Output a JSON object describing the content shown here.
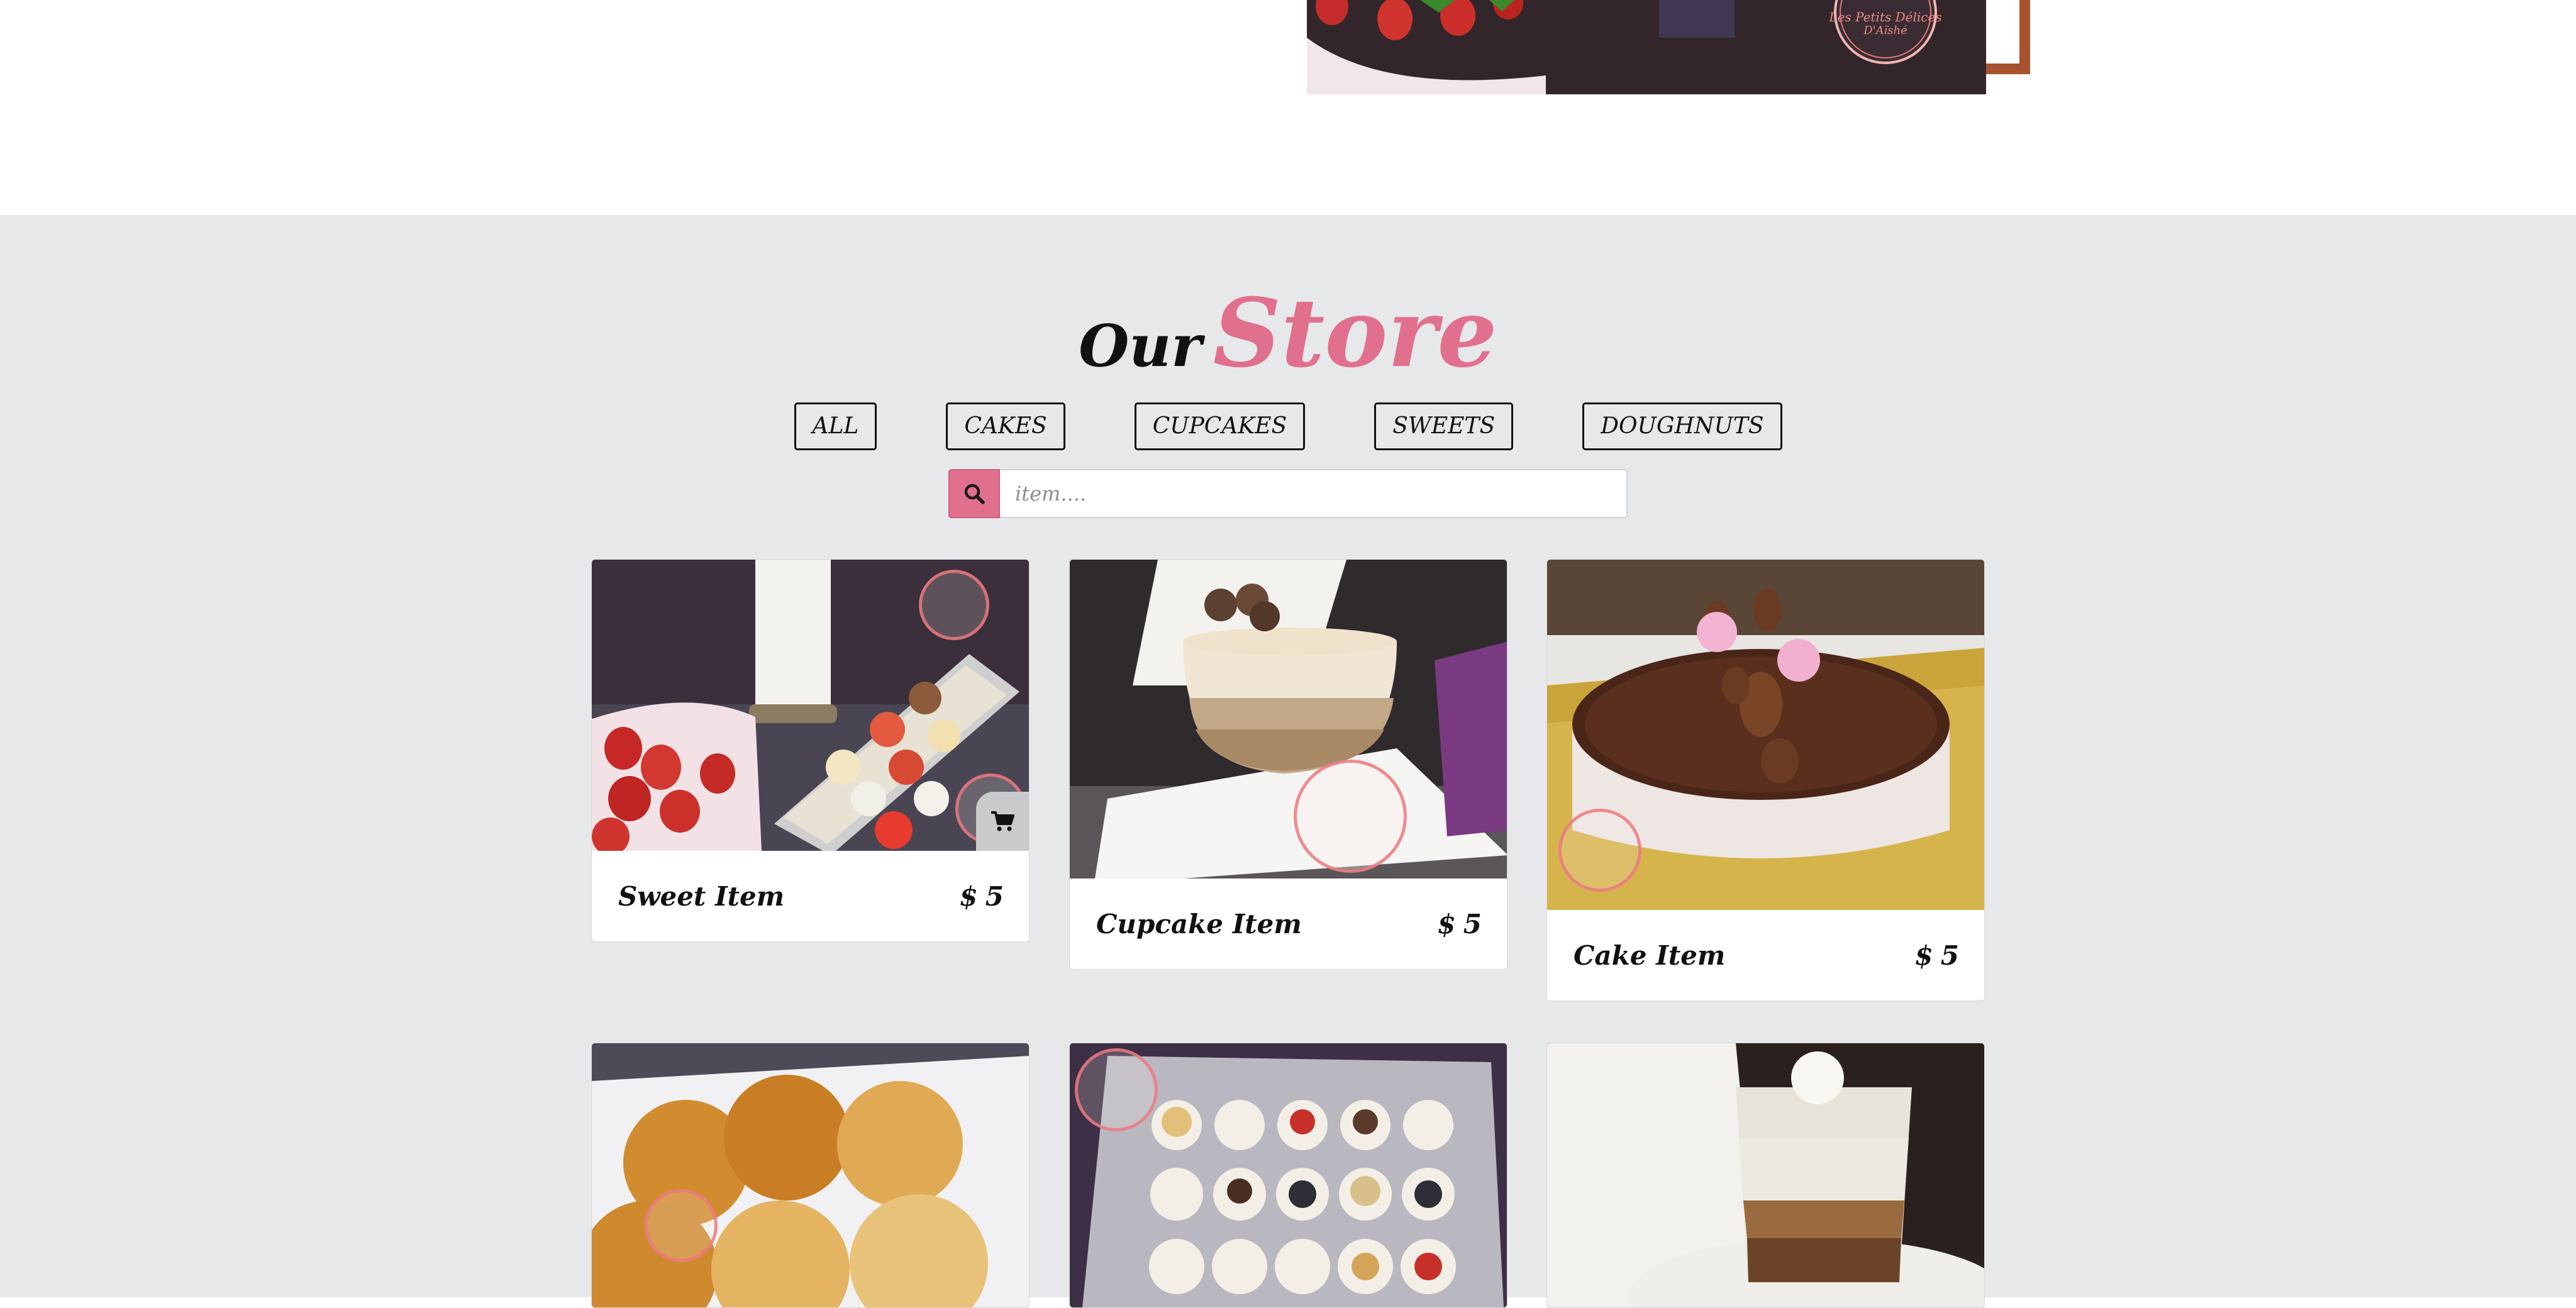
{
  "store": {
    "title_word1": "Our",
    "title_word2": "Store",
    "filters": [
      "ALL",
      "CAKES",
      "CUPCAKES",
      "SWEETS",
      "DOUGHNUTS"
    ],
    "search": {
      "placeholder": "item...."
    }
  },
  "products": [
    {
      "name": "Sweet Item",
      "currency": "$",
      "price": "5"
    },
    {
      "name": "Cupcake Item",
      "currency": "$",
      "price": "5"
    },
    {
      "name": "Cake Item",
      "currency": "$",
      "price": "5"
    }
  ],
  "logo": {
    "line1": "Les Petits Délices",
    "line2": "D'Aïshé"
  },
  "colors": {
    "accent_pink": "#e1708e",
    "section_bg": "#e7e8ea",
    "frame_brown": "#a6522d"
  },
  "icons": {
    "search": "search-icon",
    "cart": "cart-icon"
  }
}
